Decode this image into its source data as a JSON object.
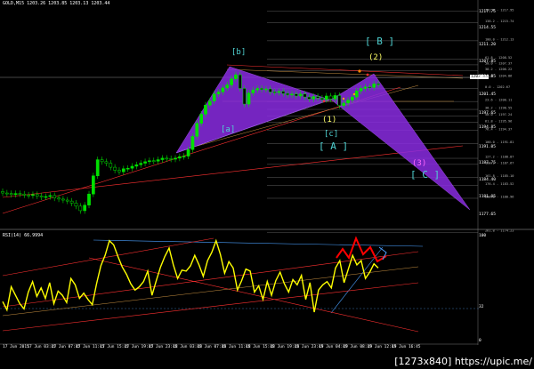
{
  "header": {
    "symbol_line": "GOLD,M15  1203.26 1203.85 1203.13 1203.44",
    "rsi_line": "RSI(14) 66.9994"
  },
  "watermark": "[1273x840] https://upic.me/",
  "current_price": "1203.44",
  "price_axis": [
    "1217.75",
    "1214.55",
    "1211.20",
    "1207.85",
    "1204.85",
    "1201.45",
    "1197.65",
    "1194.85",
    "1191.05",
    "1187.75",
    "1184.40",
    "1181.05",
    "1177.65"
  ],
  "rsi_axis": [
    "100",
    "32",
    "0"
  ],
  "time_axis": [
    "17 Jun 2015",
    "17 Jun 03:45",
    "17 Jun 07:45",
    "17 Jun 11:45",
    "17 Jun 15:45",
    "17 Jun 19:45",
    "17 Jun 23:45",
    "18 Jun 03:45",
    "18 Jun 07:45",
    "18 Jun 11:45",
    "18 Jun 15:45",
    "18 Jun 19:45",
    "18 Jun 23:45",
    "19 Jun 04:45",
    "19 Jun 08:45",
    "19 Jun 12:45",
    "19 Jun 16:45"
  ],
  "wave_labels": {
    "b_small": "[b]",
    "a_small": "[a]",
    "c_small": "[c]",
    "one": "(1)",
    "two": "(2)",
    "three": "(3)",
    "A": "[ A ]",
    "B": "[ B ]",
    "C": "[ C ]"
  },
  "fib_levels": [
    {
      "label": "161.8 - 1217.95",
      "price": 1217.95
    },
    {
      "label": "138.2 - 1215.74",
      "price": 1215.74
    },
    {
      "label": "100.0 - 1212.13",
      "price": 1212.13
    },
    {
      "label": "61.8 - 1208.52",
      "price": 1208.52
    },
    {
      "label": "50.0 - 1207.37",
      "price": 1207.37
    },
    {
      "label": "38.2 - 1206.22",
      "price": 1206.22
    },
    {
      "label": "23.6 - 1204.86",
      "price": 1204.86
    },
    {
      "label": "0.0 - 1202.67",
      "price": 1202.67
    },
    {
      "label": "23.6 - 1200.11",
      "price": 1200.11
    },
    {
      "label": "38.2 - 1198.55",
      "price": 1198.55
    },
    {
      "label": "50.0 - 1197.24",
      "price": 1197.24
    },
    {
      "label": "61.8 - 1195.96",
      "price": 1195.96
    },
    {
      "label": "76.4 - 1194.37",
      "price": 1194.37
    },
    {
      "label": "100.0 - 1191.81",
      "price": 1191.81
    },
    {
      "label": "127.2 - 1188.87",
      "price": 1188.87
    },
    {
      "label": "138.2 - 1187.67",
      "price": 1187.67
    },
    {
      "label": "161.8 - 1185.10",
      "price": 1185.1
    },
    {
      "label": "176.4 - 1183.52",
      "price": 1183.52
    },
    {
      "label": "200.0 - 1180.96",
      "price": 1180.96
    },
    {
      "label": "261.8 - 1174.23",
      "price": 1174.23
    }
  ],
  "colors": {
    "background": "#000000",
    "bull_candle": "#00e000",
    "pattern_fill": "#8a2be2",
    "rsi_line": "#ffff00",
    "wave_cyan": "#4fd2d2",
    "wave_yellow": "#ffff66",
    "wave_magenta": "#ff66ff",
    "trend_red": "#ff3030",
    "rsi_projection": "#ff0000",
    "channel_blue": "#4aa0ff"
  },
  "chart_data": {
    "type": "line",
    "title": "",
    "xlabel": "",
    "ylabel": "",
    "ylim": [
      1175.5,
      1219.5
    ],
    "grid": false,
    "price_series": [
      1182.0,
      1181.9,
      1181.7,
      1181.9,
      1181.8,
      1181.6,
      1181.5,
      1181.7,
      1181.4,
      1181.2,
      1181.3,
      1181.5,
      1181.0,
      1180.8,
      1180.6,
      1180.4,
      1180.0,
      1179.4,
      1178.5,
      1179.6,
      1181.8,
      1185.4,
      1188.6,
      1188.2,
      1187.9,
      1187.1,
      1186.5,
      1186.2,
      1186.8,
      1186.9,
      1187.3,
      1187.6,
      1187.9,
      1188.2,
      1188.4,
      1188.3,
      1188.6,
      1188.9,
      1188.8,
      1188.7,
      1188.9,
      1189.2,
      1189.3,
      1190.6,
      1193.2,
      1195.8,
      1197.6,
      1199.4,
      1200.2,
      1201.6,
      1202.0,
      1202.8,
      1203.4,
      1204.6,
      1205.4,
      1202.7,
      1199.6,
      1201.8,
      1202.4,
      1202.7,
      1202.5,
      1202.6,
      1202.0,
      1201.9,
      1202.1,
      1201.7,
      1201.4,
      1201.6,
      1201.2,
      1201.6,
      1201.0,
      1200.6,
      1201.1,
      1200.8,
      1200.5,
      1201.2,
      1200.6,
      1201.3,
      1199.3,
      1199.8,
      1200.4,
      1201.0,
      1202.2,
      1202.7,
      1203.0,
      1202.9,
      1203.6,
      1203.44
    ],
    "rsi_series": [
      38,
      30,
      52,
      44,
      36,
      31,
      47,
      57,
      43,
      51,
      41,
      56,
      36,
      48,
      44,
      37,
      60,
      54,
      41,
      46,
      40,
      35,
      55,
      72,
      82,
      96,
      92,
      81,
      71,
      64,
      55,
      49,
      52,
      57,
      67,
      44,
      58,
      71,
      81,
      89,
      73,
      60,
      68,
      67,
      72,
      82,
      73,
      62,
      77,
      85,
      96,
      83,
      65,
      76,
      70,
      49,
      58,
      69,
      67,
      47,
      53,
      40,
      57,
      44,
      58,
      66,
      55,
      47,
      59,
      54,
      63,
      40,
      56,
      28,
      49,
      54,
      57,
      51,
      70,
      77,
      56,
      69,
      82,
      73,
      77,
      60,
      66,
      74,
      70
    ],
    "rsi_ylim": [
      0,
      100
    ],
    "rsi_levels": [
      32
    ]
  }
}
